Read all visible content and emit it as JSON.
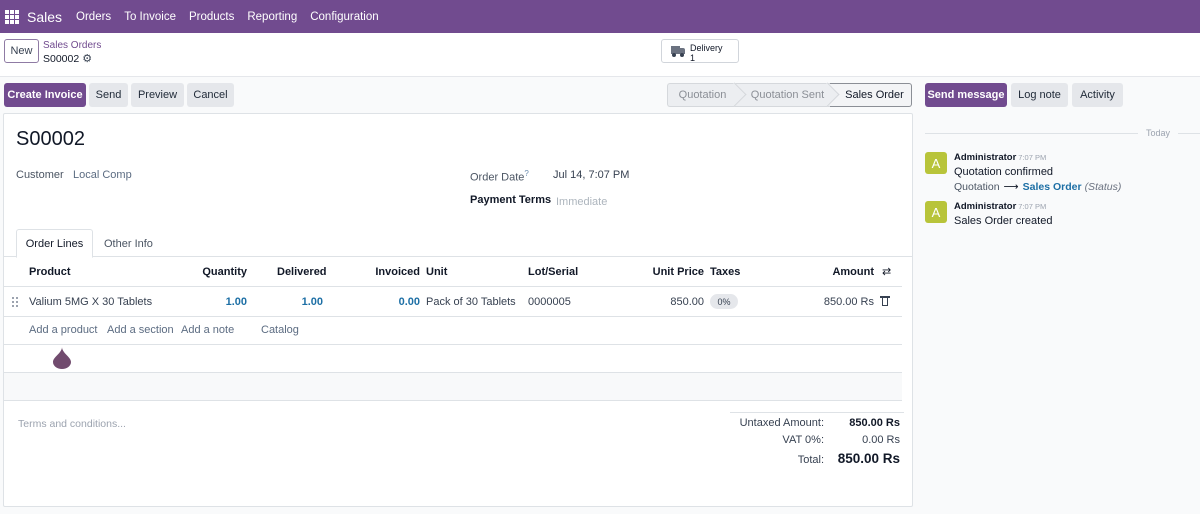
{
  "topnav": {
    "app_name": "Sales",
    "menu": [
      "Orders",
      "To Invoice",
      "Products",
      "Reporting",
      "Configuration"
    ]
  },
  "control_panel": {
    "new_label": "New",
    "breadcrumb_parent": "Sales Orders",
    "breadcrumb_current": "S00002",
    "delivery_label": "Delivery",
    "delivery_count": "1"
  },
  "actions": {
    "create_invoice": "Create Invoice",
    "send": "Send",
    "preview": "Preview",
    "cancel": "Cancel"
  },
  "status": {
    "stages": [
      "Quotation",
      "Quotation Sent",
      "Sales Order"
    ],
    "current": "Sales Order"
  },
  "form": {
    "title": "S00002",
    "customer_label": "Customer",
    "customer_value": "Local Comp",
    "order_date_label": "Order Date",
    "order_date_help": "?",
    "order_date_value": "Jul 14, 7:07 PM",
    "payment_terms_label": "Payment Terms",
    "payment_terms_placeholder": "Immediate"
  },
  "tabs": [
    "Order Lines",
    "Other Info"
  ],
  "order_lines": {
    "headers": [
      "Product",
      "Quantity",
      "Delivered",
      "Invoiced",
      "Unit",
      "Lot/Serial",
      "Unit Price",
      "Taxes",
      "Amount"
    ],
    "rows": [
      {
        "product": "Valium 5MG X 30 Tablets",
        "quantity": "1.00",
        "delivered": "1.00",
        "invoiced": "0.00",
        "unit": "Pack of 30 Tablets",
        "lot": "0000005",
        "unit_price": "850.00",
        "taxes": "0%",
        "amount": "850.00 Rs"
      }
    ],
    "add_links": [
      "Add a product",
      "Add a section",
      "Add a note",
      "Catalog"
    ]
  },
  "terms_placeholder": "Terms and conditions...",
  "totals": {
    "untaxed_label": "Untaxed Amount:",
    "untaxed_value": "850.00 Rs",
    "vat_label": "VAT 0%:",
    "vat_value": "0.00 Rs",
    "total_label": "Total:",
    "total_value": "850.00 Rs"
  },
  "chatter": {
    "send_message": "Send message",
    "log_note": "Log note",
    "activity": "Activity",
    "today": "Today",
    "messages": [
      {
        "avatar": "A",
        "author": "Administrator",
        "time": "7:07 PM",
        "body": "Quotation confirmed",
        "tracking": {
          "old": "Quotation",
          "new": "Sales Order",
          "field": "(Status)"
        }
      },
      {
        "avatar": "A",
        "author": "Administrator",
        "time": "7:07 PM",
        "body": "Sales Order created"
      }
    ]
  },
  "colors": {
    "brand": "#714b8f",
    "link_number": "#1d6fa5",
    "avatar": "#b8c43a"
  }
}
